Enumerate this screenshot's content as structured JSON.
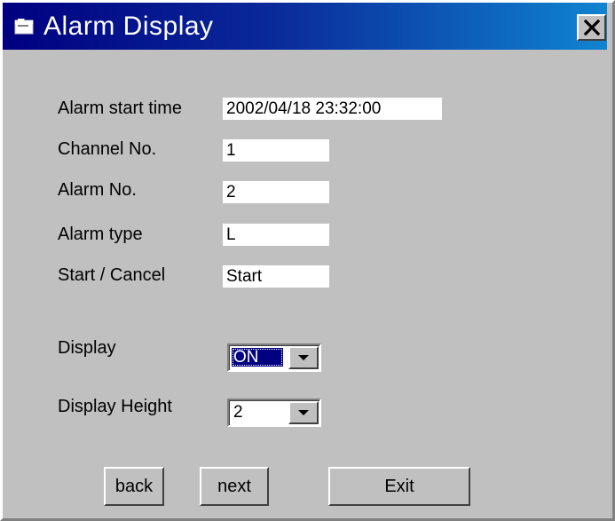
{
  "window": {
    "title": "Alarm Display",
    "close_glyph": "✕",
    "title_icon": "window-app-icon"
  },
  "fields": [
    {
      "label": "Alarm start time",
      "value": "2002/04/18 23:32:00"
    },
    {
      "label": "Channel No.",
      "value": "1"
    },
    {
      "label": "Alarm No.",
      "value": "2"
    },
    {
      "label": "Alarm type",
      "value": "L"
    },
    {
      "label": "Start / Cancel",
      "value": "Start"
    }
  ],
  "display": {
    "label": "Display",
    "selected": "ON"
  },
  "display_height": {
    "label": "Display Height",
    "selected": "2"
  },
  "buttons": {
    "back": "back",
    "next": "next",
    "exit": "Exit"
  },
  "colors": {
    "titlebar_start": "#000080",
    "titlebar_end": "#1084d0",
    "face": "#c0c0c0"
  }
}
